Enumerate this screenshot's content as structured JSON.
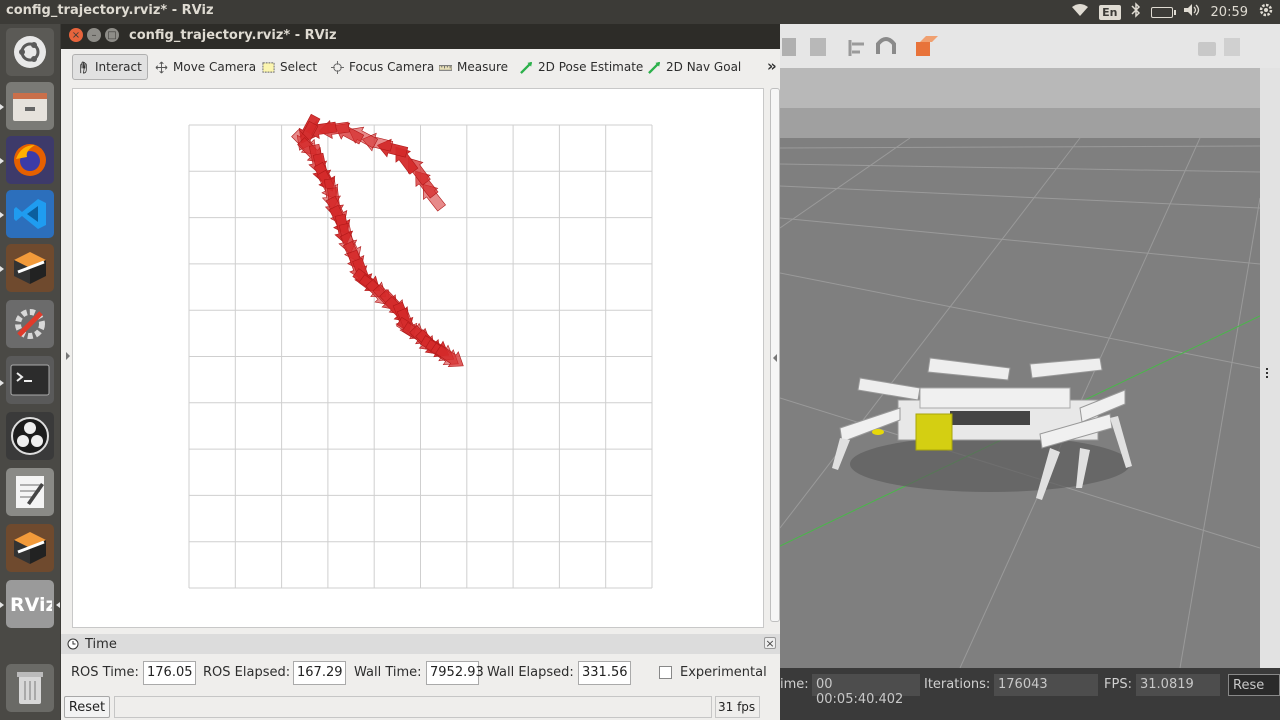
{
  "topbar": {
    "title": "config_trajectory.rviz* - RViz",
    "lang": "En",
    "clock": "20:59"
  },
  "launcher": {
    "icons": [
      "ubuntu-icon",
      "files-icon",
      "firefox-icon",
      "vscode-icon",
      "gazebo-icon",
      "settings-icon",
      "terminal-icon",
      "obs-icon",
      "text-editor-icon",
      "gazebo-icon-2",
      "rviz-icon",
      "trash-icon"
    ]
  },
  "rviz": {
    "window_title": "config_trajectory.rviz* - RViz",
    "tools": [
      "Interact",
      "Move Camera",
      "Select",
      "Focus Camera",
      "Measure",
      "2D Pose Estimate",
      "2D Nav Goal"
    ],
    "more": "»",
    "time_panel": {
      "title": "Time",
      "ros_time_label": "ROS Time:",
      "ros_time": "176.05",
      "ros_elapsed_label": "ROS Elapsed:",
      "ros_elapsed": "167.29",
      "wall_time_label": "Wall Time:",
      "wall_time": "7952.93",
      "wall_elapsed_label": "Wall Elapsed:",
      "wall_elapsed": "331.56",
      "experimental_label": "Experimental"
    },
    "reset_label": "Reset",
    "fps": "31 fps"
  },
  "gazebo": {
    "sim_time_label": "ime:",
    "sim_time": "00 00:05:40.402",
    "iterations_label": "Iterations:",
    "iterations": "176043",
    "fps_label": "FPS:",
    "fps": "31.0819",
    "reset_label": "Rese"
  },
  "colors": {
    "arrow_red": "#d42a2a",
    "ubuntu_bar": "#3c3b37"
  }
}
